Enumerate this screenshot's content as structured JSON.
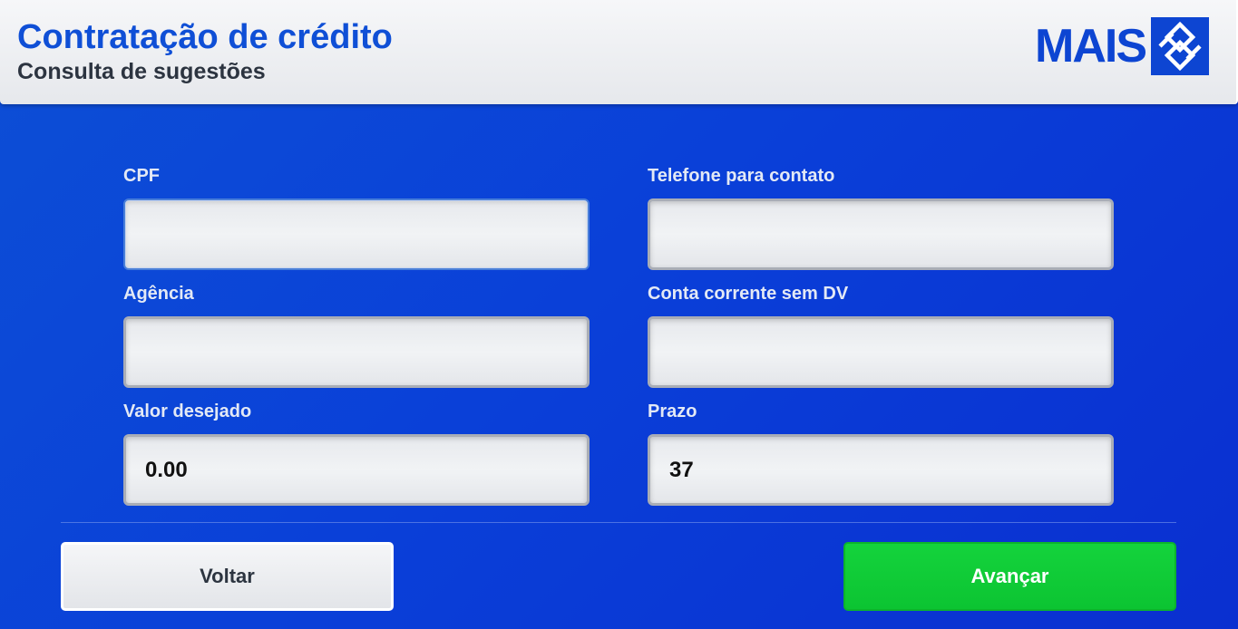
{
  "header": {
    "title": "Contratação de crédito",
    "subtitle": "Consulta de sugestões",
    "logo_text": "MAIS"
  },
  "form": {
    "cpf": {
      "label": "CPF",
      "value": ""
    },
    "telefone": {
      "label": "Telefone para contato",
      "value": ""
    },
    "agencia": {
      "label": "Agência",
      "value": ""
    },
    "conta": {
      "label": "Conta corrente sem DV",
      "value": ""
    },
    "valor": {
      "label": "Valor desejado",
      "value": "0.00"
    },
    "prazo": {
      "label": "Prazo",
      "value": "37"
    }
  },
  "actions": {
    "back_label": "Voltar",
    "next_label": "Avançar"
  },
  "colors": {
    "brand_blue": "#0d45d2",
    "background_blue": "#0a3fd8",
    "next_green": "#0cc432"
  },
  "icons": {
    "logo_mark": "banco-do-brasil-logo-icon"
  }
}
